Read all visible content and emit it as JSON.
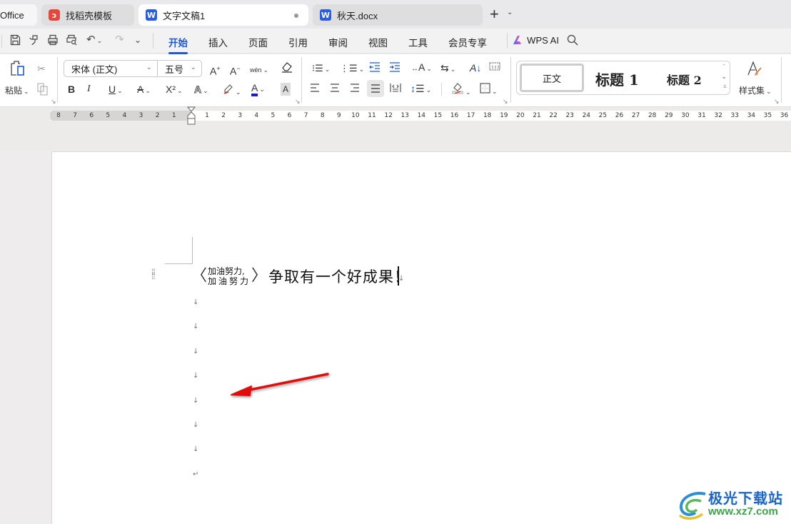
{
  "tabs": [
    {
      "label": "Office",
      "icon": "none"
    },
    {
      "label": "找稻壳模板",
      "icon": "docer-icon"
    },
    {
      "label": "文字文稿1",
      "icon": "wps-writer-icon",
      "active": true,
      "unsaved": true
    },
    {
      "label": "秋天.docx",
      "icon": "wps-writer-icon"
    }
  ],
  "quick_access": [
    "save",
    "format-painter",
    "print",
    "print-preview",
    "undo",
    "redo",
    "more"
  ],
  "menu": {
    "items": [
      "开始",
      "插入",
      "页面",
      "引用",
      "审阅",
      "视图",
      "工具",
      "会员专享"
    ],
    "active": "开始",
    "ai_label": "WPS AI"
  },
  "ribbon": {
    "paste_label": "粘贴",
    "font_name": "宋体 (正文)",
    "font_size": "五号",
    "grow_font": "A",
    "shrink_font": "A",
    "phonetic": "wén",
    "bold": "B",
    "italic": "I",
    "underline": "U",
    "strike": "A",
    "superscript": "X²",
    "text_effect": "A",
    "font_color": "A",
    "char_shading": "A",
    "styles": {
      "normal": "正文",
      "heading1": "标题 1",
      "heading2": "标题 2"
    },
    "style_set_label": "样式集",
    "font_color_hex": "#1a1ad8",
    "accent_hex": "#1d59d8"
  },
  "ruler": {
    "left_numbers": [
      "8",
      "7",
      "6",
      "5",
      "4",
      "3",
      "2",
      "1"
    ],
    "right_numbers": [
      "1",
      "2",
      "3",
      "4",
      "5",
      "6",
      "7",
      "8",
      "9",
      "10",
      "11",
      "12",
      "13",
      "14",
      "15",
      "16",
      "17",
      "18",
      "19",
      "20",
      "21",
      "22",
      "23",
      "24",
      "25",
      "26",
      "27",
      "28",
      "29",
      "30",
      "31",
      "32",
      "33",
      "34",
      "35",
      "36"
    ]
  },
  "document": {
    "combined_chars_line1": "加油努力,",
    "combined_chars_line2": "加油努力",
    "bracket_left": "〈",
    "bracket_right": "〉",
    "text": "争取有一个好成果！",
    "empty_paragraph_mark": "↓",
    "final_paragraph_mark": "↵",
    "empty_paragraphs": 7
  },
  "annotation": {
    "type": "arrow",
    "color": "#e01010"
  },
  "watermark": {
    "title": "极光下载站",
    "url": "www.xz7.com"
  }
}
